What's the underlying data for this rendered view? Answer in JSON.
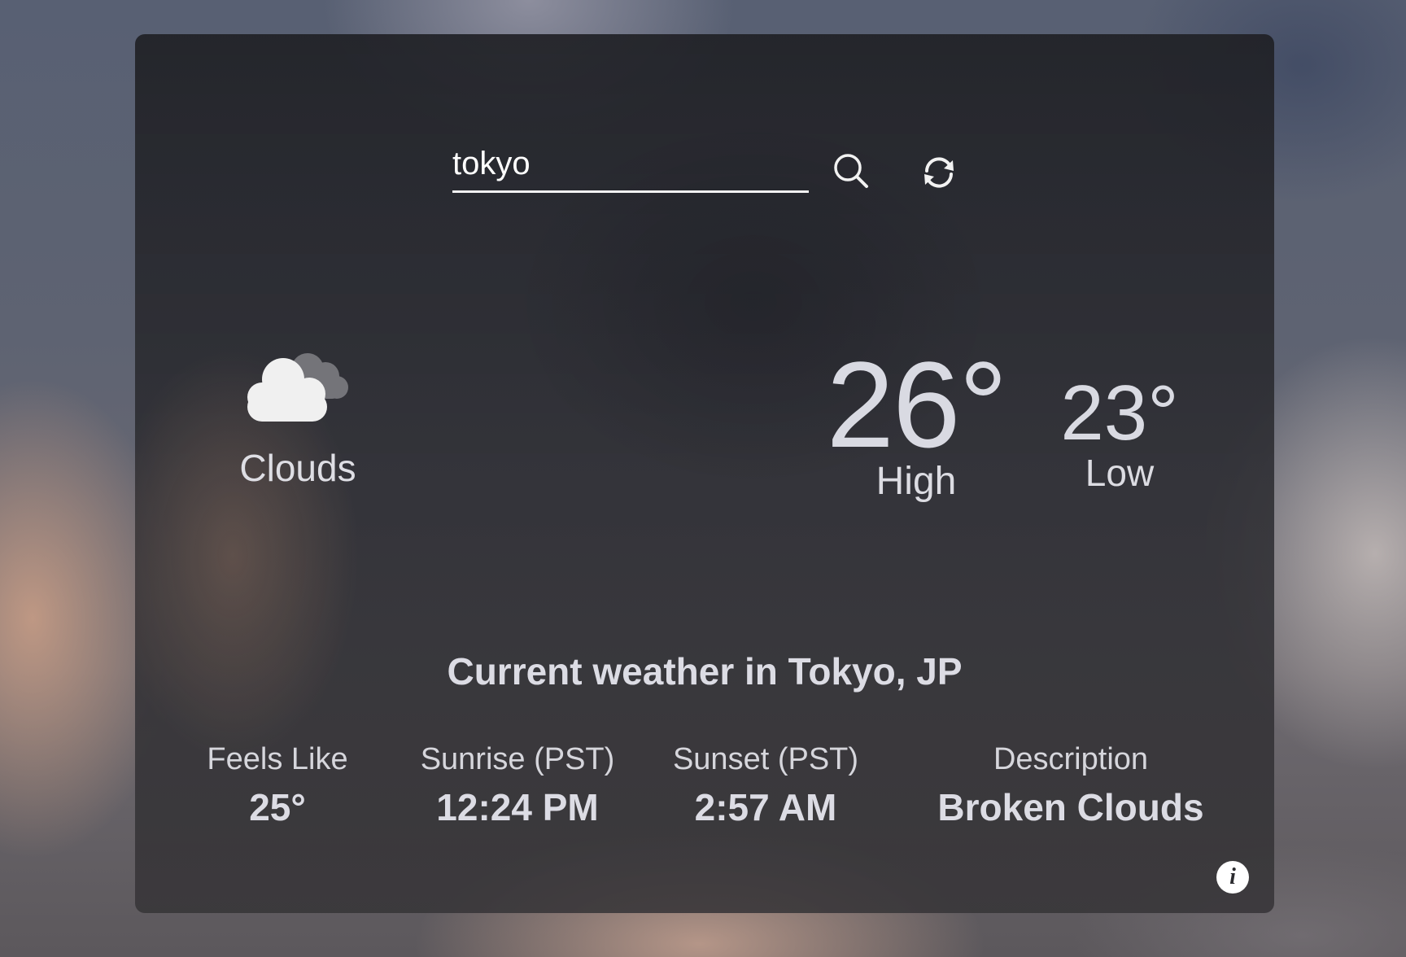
{
  "search": {
    "value": "tokyo",
    "search_icon": "search-icon",
    "refresh_icon": "refresh-icon"
  },
  "current": {
    "condition_icon": "cloud-icon",
    "condition": "Clouds",
    "high_value": "26°",
    "high_label": "High",
    "low_value": "23°",
    "low_label": "Low"
  },
  "location": {
    "heading": "Current weather in Tokyo, JP"
  },
  "details": {
    "feels_like_label": "Feels Like",
    "feels_like_value": "25°",
    "sunrise_label": "Sunrise (PST)",
    "sunrise_value": "12:24 PM",
    "sunset_label": "Sunset (PST)",
    "sunset_value": "2:57 AM",
    "description_label": "Description",
    "description_value": "Broken Clouds"
  },
  "footer": {
    "info_icon": "info-icon",
    "info_glyph": "i"
  },
  "colors": {
    "text": "#d8d8de",
    "card": "#2a2b30",
    "input_underline": "#f2f2f2"
  }
}
